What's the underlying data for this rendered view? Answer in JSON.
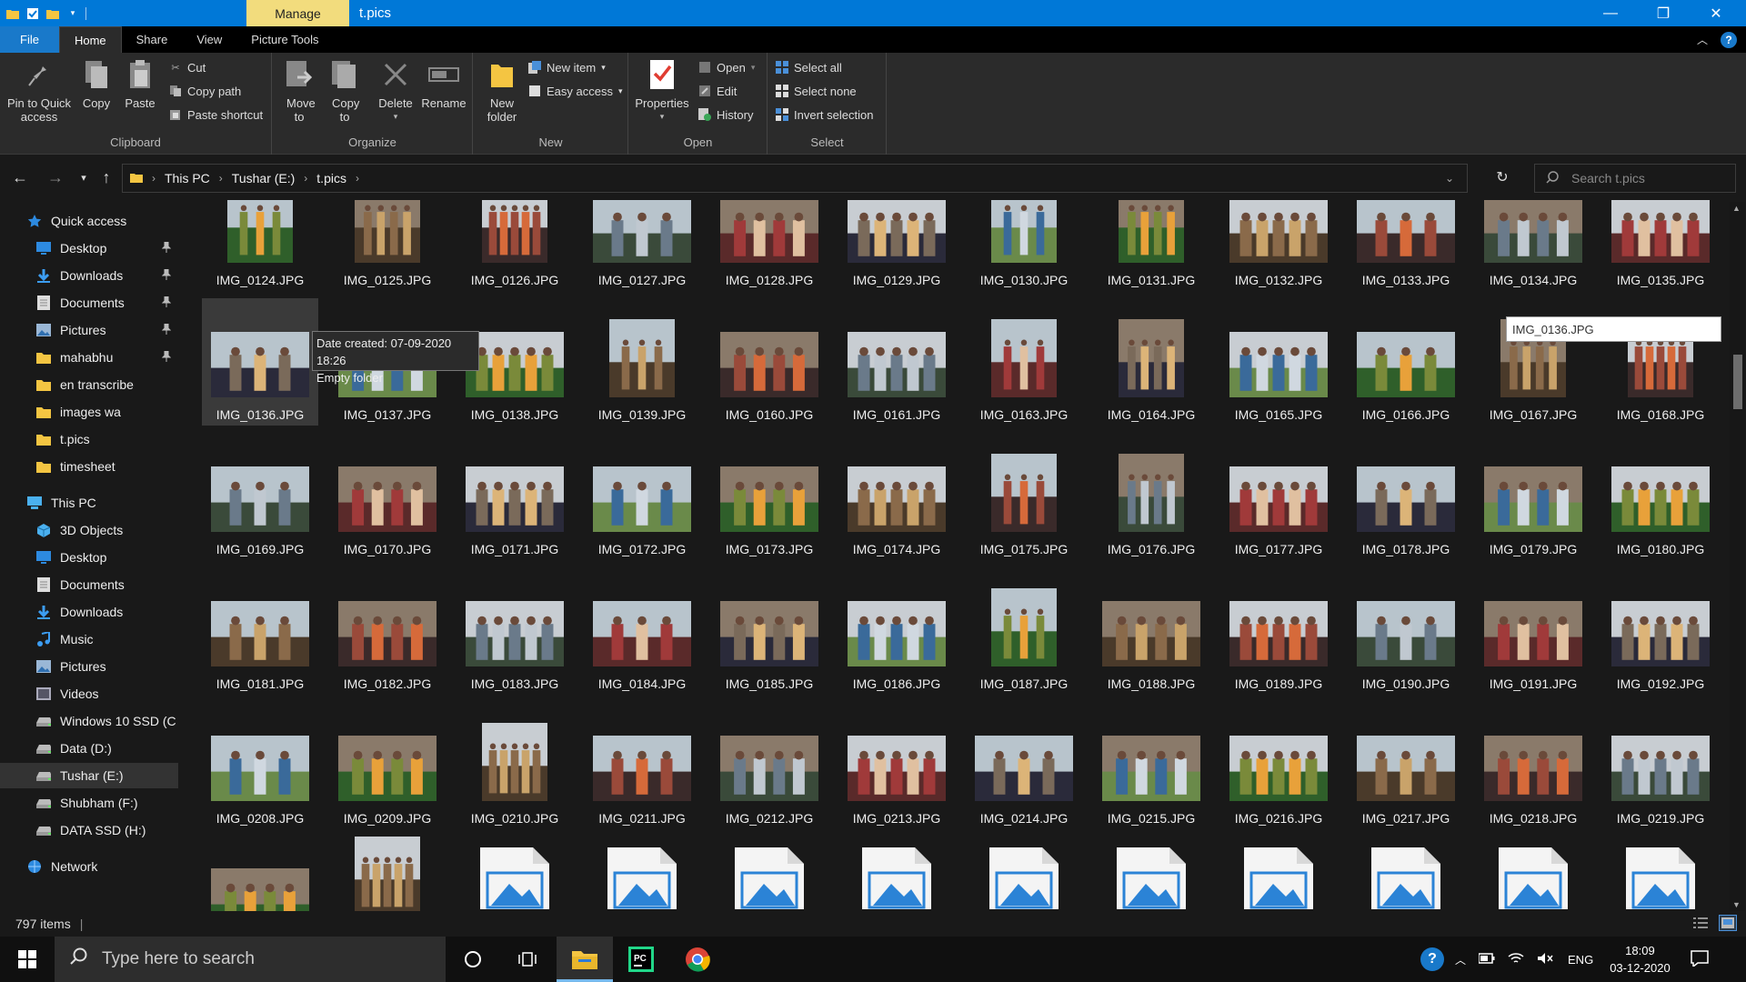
{
  "titlebar": {
    "manage_tab": "Manage",
    "title": "t.pics",
    "minimize": "—",
    "maximize": "❐",
    "close": "✕"
  },
  "ribbon_tabs": {
    "file": "File",
    "home": "Home",
    "share": "Share",
    "view": "View",
    "picture_tools": "Picture Tools"
  },
  "ribbon": {
    "clipboard": {
      "label": "Clipboard",
      "pin": "Pin to Quick access",
      "copy": "Copy",
      "paste": "Paste",
      "cut": "Cut",
      "copy_path": "Copy path",
      "paste_shortcut": "Paste shortcut"
    },
    "organize": {
      "label": "Organize",
      "move_to": "Move to",
      "copy_to": "Copy to",
      "delete": "Delete",
      "rename": "Rename"
    },
    "new": {
      "label": "New",
      "new_folder": "New folder",
      "new_item": "New item",
      "easy_access": "Easy access"
    },
    "open": {
      "label": "Open",
      "properties": "Properties",
      "open": "Open",
      "edit": "Edit",
      "history": "History"
    },
    "select": {
      "label": "Select",
      "select_all": "Select all",
      "select_none": "Select none",
      "invert_selection": "Invert selection"
    }
  },
  "address": {
    "crumbs": [
      "This PC",
      "Tushar (E:)",
      "t.pics"
    ],
    "search_placeholder": "Search t.pics"
  },
  "nav": {
    "quick_access": "Quick access",
    "quick_items": [
      {
        "label": "Desktop",
        "pinned": true,
        "icon": "desktop-icon"
      },
      {
        "label": "Downloads",
        "pinned": true,
        "icon": "downloads-icon"
      },
      {
        "label": "Documents",
        "pinned": true,
        "icon": "documents-icon"
      },
      {
        "label": "Pictures",
        "pinned": true,
        "icon": "pictures-icon"
      },
      {
        "label": "mahabhu",
        "pinned": true,
        "icon": "folder-icon"
      },
      {
        "label": "en transcribe",
        "pinned": false,
        "icon": "folder-icon"
      },
      {
        "label": "images wa",
        "pinned": false,
        "icon": "folder-icon"
      },
      {
        "label": "t.pics",
        "pinned": false,
        "icon": "folder-icon"
      },
      {
        "label": "timesheet",
        "pinned": false,
        "icon": "folder-icon"
      }
    ],
    "this_pc": "This PC",
    "pc_items": [
      {
        "label": "3D Objects",
        "icon": "3d-objects-icon"
      },
      {
        "label": "Desktop",
        "icon": "desktop-icon"
      },
      {
        "label": "Documents",
        "icon": "documents-icon"
      },
      {
        "label": "Downloads",
        "icon": "downloads-icon"
      },
      {
        "label": "Music",
        "icon": "music-icon"
      },
      {
        "label": "Pictures",
        "icon": "pictures-icon"
      },
      {
        "label": "Videos",
        "icon": "videos-icon"
      },
      {
        "label": "Windows 10 SSD (C",
        "icon": "drive-icon"
      },
      {
        "label": "Data (D:)",
        "icon": "drive-icon"
      },
      {
        "label": "Tushar (E:)",
        "icon": "drive-icon"
      },
      {
        "label": "Shubham (F:)",
        "icon": "drive-icon"
      },
      {
        "label": "DATA SSD (H:)",
        "icon": "drive-icon"
      }
    ],
    "network": "Network"
  },
  "files": {
    "rows": [
      [
        "IMG_0124.JPG",
        "IMG_0125.JPG",
        "IMG_0126.JPG",
        "IMG_0127.JPG",
        "IMG_0128.JPG",
        "IMG_0129.JPG",
        "IMG_0130.JPG",
        "IMG_0131.JPG",
        "IMG_0132.JPG",
        "IMG_0133.JPG",
        "IMG_0134.JPG",
        "IMG_0135.JPG"
      ],
      [
        "IMG_0136.JPG",
        "IMG_0137.JPG",
        "IMG_0138.JPG",
        "IMG_0139.JPG",
        "IMG_0160.JPG",
        "IMG_0161.JPG",
        "IMG_0163.JPG",
        "IMG_0164.JPG",
        "IMG_0165.JPG",
        "IMG_0166.JPG",
        "IMG_0167.JPG",
        "IMG_0168.JPG"
      ],
      [
        "IMG_0169.JPG",
        "IMG_0170.JPG",
        "IMG_0171.JPG",
        "IMG_0172.JPG",
        "IMG_0173.JPG",
        "IMG_0174.JPG",
        "IMG_0175.JPG",
        "IMG_0176.JPG",
        "IMG_0177.JPG",
        "IMG_0178.JPG",
        "IMG_0179.JPG",
        "IMG_0180.JPG"
      ],
      [
        "IMG_0181.JPG",
        "IMG_0182.JPG",
        "IMG_0183.JPG",
        "IMG_0184.JPG",
        "IMG_0185.JPG",
        "IMG_0186.JPG",
        "IMG_0187.JPG",
        "IMG_0188.JPG",
        "IMG_0189.JPG",
        "IMG_0190.JPG",
        "IMG_0191.JPG",
        "IMG_0192.JPG"
      ],
      [
        "IMG_0208.JPG",
        "IMG_0209.JPG",
        "IMG_0210.JPG",
        "IMG_0211.JPG",
        "IMG_0212.JPG",
        "IMG_0213.JPG",
        "IMG_0214.JPG",
        "IMG_0215.JPG",
        "IMG_0216.JPG",
        "IMG_0217.JPG",
        "IMG_0218.JPG",
        "IMG_0219.JPG"
      ]
    ],
    "selected": "IMG_0136.JPG"
  },
  "tooltip": {
    "line1": "Date created: 07-09-2020 18:26",
    "line2": "Empty folder"
  },
  "rename_box": "IMG_0136.JPG",
  "status": {
    "count": "797 items"
  },
  "taskbar": {
    "search_placeholder": "Type here to search",
    "lang": "ENG",
    "time": "18:09",
    "date": "03-12-2020"
  }
}
